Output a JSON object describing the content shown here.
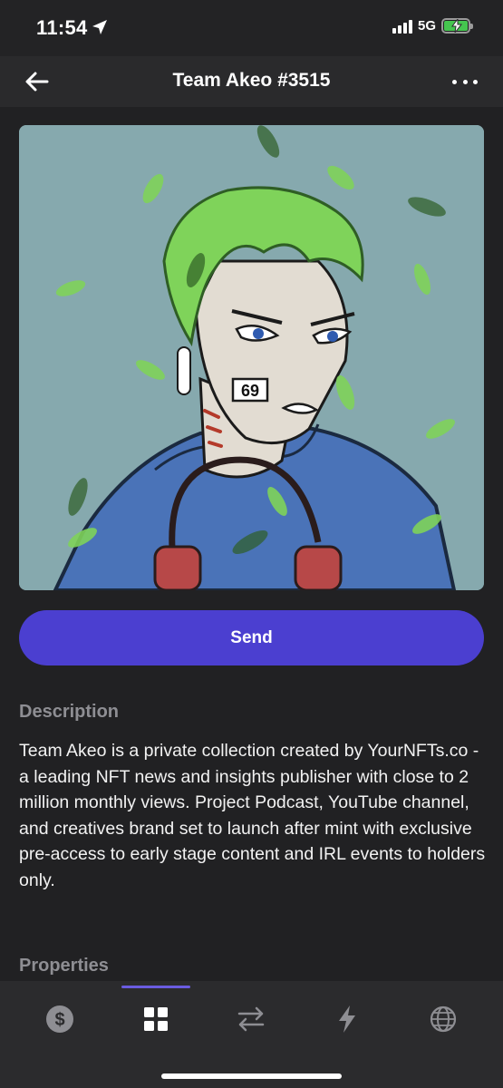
{
  "status_bar": {
    "time": "11:54",
    "network": "5G",
    "battery_fill": 1.0,
    "signal_bars": 4
  },
  "nav": {
    "title": "Team Akeo #3515",
    "back_icon": "arrow-left-icon",
    "more_icon": "more-horizontal-icon"
  },
  "nft": {
    "cheek_number": "69",
    "background_color": "#86a9ae",
    "hair_color": "#7fd35a",
    "hoodie_color": "#4a73b8"
  },
  "actions": {
    "send_label": "Send",
    "send_color": "#4b3fd0"
  },
  "description": {
    "heading": "Description",
    "text": "Team Akeo is a private collection created by YourNFTs.co - a leading NFT news and insights publisher with close to 2 million monthly views. Project Podcast, YouTube channel, and creatives brand set to launch after mint with exclusive pre-access to early stage content and IRL events to holders only."
  },
  "properties": {
    "heading": "Properties"
  },
  "tab_bar": {
    "tabs": [
      {
        "icon": "dollar-icon",
        "active": false
      },
      {
        "icon": "grid-icon",
        "active": true
      },
      {
        "icon": "swap-arrows-icon",
        "active": false
      },
      {
        "icon": "lightning-icon",
        "active": false
      },
      {
        "icon": "globe-icon",
        "active": false
      }
    ],
    "accent": "#6a5ce0"
  }
}
